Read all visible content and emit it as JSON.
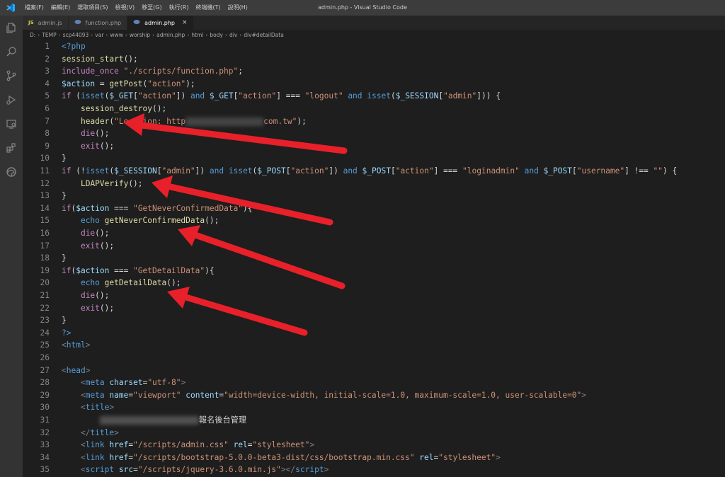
{
  "menu": [
    "檔案(F)",
    "編輯(E)",
    "選取項目(S)",
    "檢視(V)",
    "移至(G)",
    "執行(R)",
    "終端機(T)",
    "說明(H)"
  ],
  "window_title": "admin.php - Visual Studio Code",
  "tabs": [
    {
      "label": "admin.js",
      "type": "JS"
    },
    {
      "label": "function.php"
    },
    {
      "label": "admin.php",
      "close": "×"
    }
  ],
  "breadcrumb": [
    "D:",
    "TEMP",
    "scp44093",
    "var",
    "www",
    "worship",
    "admin.php",
    "html",
    "body",
    "div",
    "div#detailData"
  ],
  "colors": {
    "keyword": "#c586c0",
    "function": "#dcdcaa",
    "string": "#ce9178",
    "variable": "#9cdcfe",
    "tag": "#569cd6",
    "arrow": "#e8202a"
  },
  "lines": [
    {
      "n": "1",
      "segs": [
        [
          "<?php",
          "#569cd6"
        ]
      ]
    },
    {
      "n": "2",
      "segs": [
        [
          "session_start",
          "#dcdcaa"
        ],
        [
          "();",
          "#d4d4d4"
        ]
      ]
    },
    {
      "n": "3",
      "segs": [
        [
          "include_once",
          "#c586c0"
        ],
        [
          " ",
          "#d4d4d4"
        ],
        [
          "\"./scripts/function.php\"",
          "#ce9178"
        ],
        [
          ";",
          "#d4d4d4"
        ]
      ]
    },
    {
      "n": "4",
      "segs": [
        [
          "$action",
          "#9cdcfe"
        ],
        [
          " = ",
          "#d4d4d4"
        ],
        [
          "getPost",
          "#dcdcaa"
        ],
        [
          "(",
          "#d4d4d4"
        ],
        [
          "\"action\"",
          "#ce9178"
        ],
        [
          ");",
          "#d4d4d4"
        ]
      ]
    },
    {
      "n": "5",
      "segs": [
        [
          "if",
          "#c586c0"
        ],
        [
          " (",
          "#d4d4d4"
        ],
        [
          "isset",
          "#569cd6"
        ],
        [
          "(",
          "#d4d4d4"
        ],
        [
          "$_GET",
          "#9cdcfe"
        ],
        [
          "[",
          "#d4d4d4"
        ],
        [
          "\"action\"",
          "#ce9178"
        ],
        [
          "]) ",
          "#d4d4d4"
        ],
        [
          "and",
          "#569cd6"
        ],
        [
          " ",
          "#d4d4d4"
        ],
        [
          "$_GET",
          "#9cdcfe"
        ],
        [
          "[",
          "#d4d4d4"
        ],
        [
          "\"action\"",
          "#ce9178"
        ],
        [
          "] === ",
          "#d4d4d4"
        ],
        [
          "\"logout\"",
          "#ce9178"
        ],
        [
          " ",
          "#d4d4d4"
        ],
        [
          "and",
          "#569cd6"
        ],
        [
          " ",
          "#d4d4d4"
        ],
        [
          "isset",
          "#569cd6"
        ],
        [
          "(",
          "#d4d4d4"
        ],
        [
          "$_SESSION",
          "#9cdcfe"
        ],
        [
          "[",
          "#d4d4d4"
        ],
        [
          "\"admin\"",
          "#ce9178"
        ],
        [
          "])) {",
          "#d4d4d4"
        ]
      ]
    },
    {
      "n": "6",
      "segs": [
        [
          "    ",
          "#d4d4d4"
        ],
        [
          "session_destroy",
          "#dcdcaa"
        ],
        [
          "();",
          "#d4d4d4"
        ]
      ]
    },
    {
      "n": "7",
      "segs": [
        [
          "    ",
          "#d4d4d4"
        ],
        [
          "header",
          "#dcdcaa"
        ],
        [
          "(",
          "#d4d4d4"
        ],
        [
          "\"Location: http",
          "#ce9178"
        ],
        [
          "BLUR",
          ""
        ],
        [
          "com.tw\"",
          "#ce9178"
        ],
        [
          ");",
          "#d4d4d4"
        ]
      ]
    },
    {
      "n": "8",
      "segs": [
        [
          "    ",
          "#d4d4d4"
        ],
        [
          "die",
          "#c586c0"
        ],
        [
          "();",
          "#d4d4d4"
        ]
      ]
    },
    {
      "n": "9",
      "segs": [
        [
          "    ",
          "#d4d4d4"
        ],
        [
          "exit",
          "#c586c0"
        ],
        [
          "();",
          "#d4d4d4"
        ]
      ]
    },
    {
      "n": "10",
      "segs": [
        [
          "}",
          "#d4d4d4"
        ]
      ]
    },
    {
      "n": "11",
      "segs": [
        [
          "if",
          "#c586c0"
        ],
        [
          " (!",
          "#d4d4d4"
        ],
        [
          "isset",
          "#569cd6"
        ],
        [
          "(",
          "#d4d4d4"
        ],
        [
          "$_SESSION",
          "#9cdcfe"
        ],
        [
          "[",
          "#d4d4d4"
        ],
        [
          "\"admin\"",
          "#ce9178"
        ],
        [
          "]) ",
          "#d4d4d4"
        ],
        [
          "and",
          "#569cd6"
        ],
        [
          " ",
          "#d4d4d4"
        ],
        [
          "isset",
          "#569cd6"
        ],
        [
          "(",
          "#d4d4d4"
        ],
        [
          "$_POST",
          "#9cdcfe"
        ],
        [
          "[",
          "#d4d4d4"
        ],
        [
          "\"action\"",
          "#ce9178"
        ],
        [
          "]) ",
          "#d4d4d4"
        ],
        [
          "and",
          "#569cd6"
        ],
        [
          " ",
          "#d4d4d4"
        ],
        [
          "$_POST",
          "#9cdcfe"
        ],
        [
          "[",
          "#d4d4d4"
        ],
        [
          "\"action\"",
          "#ce9178"
        ],
        [
          "] === ",
          "#d4d4d4"
        ],
        [
          "\"loginadmin\"",
          "#ce9178"
        ],
        [
          " ",
          "#d4d4d4"
        ],
        [
          "and",
          "#569cd6"
        ],
        [
          " ",
          "#d4d4d4"
        ],
        [
          "$_POST",
          "#9cdcfe"
        ],
        [
          "[",
          "#d4d4d4"
        ],
        [
          "\"username\"",
          "#ce9178"
        ],
        [
          "] !== ",
          "#d4d4d4"
        ],
        [
          "\"\"",
          "#ce9178"
        ],
        [
          ") {",
          "#d4d4d4"
        ]
      ]
    },
    {
      "n": "12",
      "segs": [
        [
          "    ",
          "#d4d4d4"
        ],
        [
          "LDAPVerify",
          "#dcdcaa"
        ],
        [
          "();",
          "#d4d4d4"
        ]
      ]
    },
    {
      "n": "13",
      "segs": [
        [
          "}",
          "#d4d4d4"
        ]
      ]
    },
    {
      "n": "14",
      "segs": [
        [
          "if",
          "#c586c0"
        ],
        [
          "(",
          "#d4d4d4"
        ],
        [
          "$action",
          "#9cdcfe"
        ],
        [
          " === ",
          "#d4d4d4"
        ],
        [
          "\"GetNeverConfirmedData\"",
          "#ce9178"
        ],
        [
          "){",
          "#d4d4d4"
        ]
      ]
    },
    {
      "n": "15",
      "segs": [
        [
          "    ",
          "#d4d4d4"
        ],
        [
          "echo",
          "#569cd6"
        ],
        [
          " ",
          "#d4d4d4"
        ],
        [
          "getNeverConfirmedData",
          "#dcdcaa"
        ],
        [
          "();",
          "#d4d4d4"
        ]
      ]
    },
    {
      "n": "16",
      "segs": [
        [
          "    ",
          "#d4d4d4"
        ],
        [
          "die",
          "#c586c0"
        ],
        [
          "();",
          "#d4d4d4"
        ]
      ]
    },
    {
      "n": "17",
      "segs": [
        [
          "    ",
          "#d4d4d4"
        ],
        [
          "exit",
          "#c586c0"
        ],
        [
          "();",
          "#d4d4d4"
        ]
      ]
    },
    {
      "n": "18",
      "segs": [
        [
          "}",
          "#d4d4d4"
        ]
      ]
    },
    {
      "n": "19",
      "segs": [
        [
          "if",
          "#c586c0"
        ],
        [
          "(",
          "#d4d4d4"
        ],
        [
          "$action",
          "#9cdcfe"
        ],
        [
          " === ",
          "#d4d4d4"
        ],
        [
          "\"GetDetailData\"",
          "#ce9178"
        ],
        [
          "){",
          "#d4d4d4"
        ]
      ]
    },
    {
      "n": "20",
      "segs": [
        [
          "    ",
          "#d4d4d4"
        ],
        [
          "echo",
          "#569cd6"
        ],
        [
          " ",
          "#d4d4d4"
        ],
        [
          "getDetailData",
          "#dcdcaa"
        ],
        [
          "();",
          "#d4d4d4"
        ]
      ]
    },
    {
      "n": "21",
      "segs": [
        [
          "    ",
          "#d4d4d4"
        ],
        [
          "die",
          "#c586c0"
        ],
        [
          "();",
          "#d4d4d4"
        ]
      ]
    },
    {
      "n": "22",
      "segs": [
        [
          "    ",
          "#d4d4d4"
        ],
        [
          "exit",
          "#c586c0"
        ],
        [
          "();",
          "#d4d4d4"
        ]
      ]
    },
    {
      "n": "23",
      "segs": [
        [
          "}",
          "#d4d4d4"
        ]
      ]
    },
    {
      "n": "24",
      "segs": [
        [
          "?>",
          "#569cd6"
        ]
      ]
    },
    {
      "n": "25",
      "segs": [
        [
          "<",
          "#808080"
        ],
        [
          "html",
          "#569cd6"
        ],
        [
          ">",
          "#808080"
        ]
      ]
    },
    {
      "n": "26",
      "segs": []
    },
    {
      "n": "27",
      "segs": [
        [
          "<",
          "#808080"
        ],
        [
          "head",
          "#569cd6"
        ],
        [
          ">",
          "#808080"
        ]
      ]
    },
    {
      "n": "28",
      "segs": [
        [
          "    ",
          "#d4d4d4"
        ],
        [
          "<",
          "#808080"
        ],
        [
          "meta",
          "#569cd6"
        ],
        [
          " ",
          "#d4d4d4"
        ],
        [
          "charset",
          "#9cdcfe"
        ],
        [
          "=",
          "#d4d4d4"
        ],
        [
          "\"utf-8\"",
          "#ce9178"
        ],
        [
          ">",
          "#808080"
        ]
      ]
    },
    {
      "n": "29",
      "segs": [
        [
          "    ",
          "#d4d4d4"
        ],
        [
          "<",
          "#808080"
        ],
        [
          "meta",
          "#569cd6"
        ],
        [
          " ",
          "#d4d4d4"
        ],
        [
          "name",
          "#9cdcfe"
        ],
        [
          "=",
          "#d4d4d4"
        ],
        [
          "\"viewport\"",
          "#ce9178"
        ],
        [
          " ",
          "#d4d4d4"
        ],
        [
          "content",
          "#9cdcfe"
        ],
        [
          "=",
          "#d4d4d4"
        ],
        [
          "\"width=device-width, initial-scale=1.0, maximum-scale=1.0, user-scalable=0\"",
          "#ce9178"
        ],
        [
          ">",
          "#808080"
        ]
      ]
    },
    {
      "n": "30",
      "segs": [
        [
          "    ",
          "#d4d4d4"
        ],
        [
          "<",
          "#808080"
        ],
        [
          "title",
          "#569cd6"
        ],
        [
          ">",
          "#808080"
        ]
      ]
    },
    {
      "n": "31",
      "segs": [
        [
          "        ",
          "#d4d4d4"
        ],
        [
          "BLUR2",
          ""
        ],
        [
          "報名後台管理",
          "#d4d4d4"
        ]
      ]
    },
    {
      "n": "32",
      "segs": [
        [
          "    ",
          "#d4d4d4"
        ],
        [
          "</",
          "#808080"
        ],
        [
          "title",
          "#569cd6"
        ],
        [
          ">",
          "#808080"
        ]
      ]
    },
    {
      "n": "33",
      "segs": [
        [
          "    ",
          "#d4d4d4"
        ],
        [
          "<",
          "#808080"
        ],
        [
          "link",
          "#569cd6"
        ],
        [
          " ",
          "#d4d4d4"
        ],
        [
          "href",
          "#9cdcfe"
        ],
        [
          "=",
          "#d4d4d4"
        ],
        [
          "\"/scripts/admin.css\"",
          "#ce9178"
        ],
        [
          " ",
          "#d4d4d4"
        ],
        [
          "rel",
          "#9cdcfe"
        ],
        [
          "=",
          "#d4d4d4"
        ],
        [
          "\"stylesheet\"",
          "#ce9178"
        ],
        [
          ">",
          "#808080"
        ]
      ]
    },
    {
      "n": "34",
      "segs": [
        [
          "    ",
          "#d4d4d4"
        ],
        [
          "<",
          "#808080"
        ],
        [
          "link",
          "#569cd6"
        ],
        [
          " ",
          "#d4d4d4"
        ],
        [
          "href",
          "#9cdcfe"
        ],
        [
          "=",
          "#d4d4d4"
        ],
        [
          "\"/scripts/bootstrap-5.0.0-beta3-dist/css/bootstrap.min.css\"",
          "#ce9178"
        ],
        [
          " ",
          "#d4d4d4"
        ],
        [
          "rel",
          "#9cdcfe"
        ],
        [
          "=",
          "#d4d4d4"
        ],
        [
          "\"stylesheet\"",
          "#ce9178"
        ],
        [
          ">",
          "#808080"
        ]
      ]
    },
    {
      "n": "35",
      "segs": [
        [
          "    ",
          "#d4d4d4"
        ],
        [
          "<",
          "#808080"
        ],
        [
          "script",
          "#569cd6"
        ],
        [
          " ",
          "#d4d4d4"
        ],
        [
          "src",
          "#9cdcfe"
        ],
        [
          "=",
          "#d4d4d4"
        ],
        [
          "\"/scripts/jquery-3.6.0.min.js\"",
          "#ce9178"
        ],
        [
          "></",
          "#808080"
        ],
        [
          "script",
          "#569cd6"
        ],
        [
          ">",
          "#808080"
        ]
      ]
    }
  ]
}
